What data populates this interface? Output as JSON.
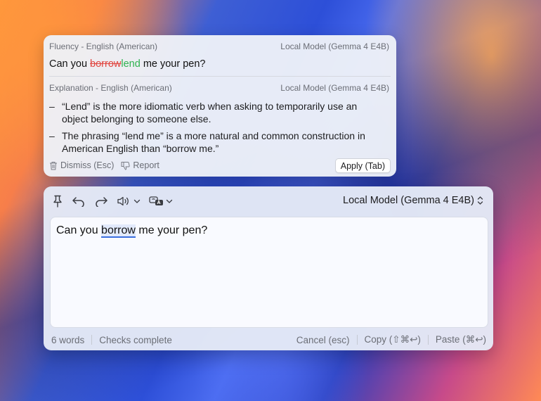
{
  "suggestion": {
    "fluency_label": "Fluency - English (American)",
    "model_label": "Local Model (Gemma 4 E4B)",
    "sentence_prefix": "Can you ",
    "removed_word": "borrow",
    "added_word": "lend",
    "sentence_suffix": " me your pen?",
    "explanation_label": "Explanation - English (American)",
    "explanation_model_label": "Local Model (Gemma 4 E4B)",
    "bullets": [
      "“Lend” is the more idiomatic verb when asking to temporarily use an object belonging to someone else.",
      "The phrasing “lend me” is a more natural and common construction in American English than “borrow me.”"
    ],
    "dismiss_label": "Dismiss (Esc)",
    "report_label": "Report",
    "apply_label": "Apply (Tab)"
  },
  "editor": {
    "model_select": "Local Model (Gemma 4 E4B)",
    "text_prefix": "Can you ",
    "flagged_word": "borrow",
    "text_suffix": " me your pen?",
    "word_count": "6 words",
    "check_status": "Checks complete",
    "cancel_label": "Cancel (esc)",
    "copy_label": "Copy (⇧⌘↩)",
    "paste_label": "Paste (⌘↩)"
  },
  "colors": {
    "removed": "#e0443e",
    "added": "#2fb24f",
    "flag_underline": "#3b6fe0"
  }
}
